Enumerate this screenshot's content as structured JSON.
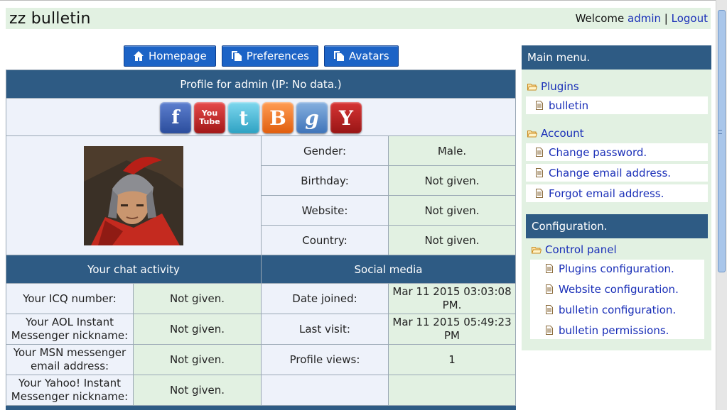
{
  "header": {
    "title": "zz bulletin",
    "welcome_text": "Welcome",
    "user_link": "admin",
    "separator": "|",
    "logout_link": "Logout"
  },
  "nav_buttons": {
    "homepage": "Homepage",
    "preferences": "Preferences",
    "avatars": "Avatars"
  },
  "profile": {
    "heading": "Profile for admin (IP: No data.)",
    "social_icons": [
      "facebook-icon",
      "youtube-icon",
      "twitter-icon",
      "blogger-icon",
      "google-icon",
      "yahoo-icon"
    ],
    "youtube_top": "You",
    "youtube_bottom": "Tube",
    "fields": [
      {
        "label": "Gender:",
        "value": "Male."
      },
      {
        "label": "Birthday:",
        "value": "Not given."
      },
      {
        "label": "Website:",
        "value": "Not given."
      },
      {
        "label": "Country:",
        "value": "Not given."
      }
    ]
  },
  "chat_activity": {
    "heading": "Your chat activity",
    "rows": [
      {
        "label": "Your ICQ number:",
        "value": "Not given."
      },
      {
        "label": "Your AOL Instant Messenger nickname:",
        "value": "Not given."
      },
      {
        "label": "Your MSN messenger email address:",
        "value": "Not given."
      },
      {
        "label": "Your Yahoo! Instant Messenger nickname:",
        "value": "Not given."
      }
    ]
  },
  "social_media": {
    "heading": "Social media",
    "rows": [
      {
        "label": "Date joined:",
        "value": "Mar 11 2015 03:03:08 PM."
      },
      {
        "label": "Last visit:",
        "value": "Mar 11 2015 05:49:23 PM"
      },
      {
        "label": "Profile views:",
        "value": "1"
      },
      {
        "label": "",
        "value": ""
      }
    ]
  },
  "sidebar": {
    "main_menu_title": "Main menu.",
    "plugins_folder": "Plugins",
    "plugins_items": [
      "bulletin"
    ],
    "account_folder": "Account",
    "account_items": [
      "Change password.",
      "Change email address.",
      "Forgot email address."
    ],
    "config_title": "Configuration.",
    "control_panel_folder": "Control panel",
    "config_items": [
      "Plugins configuration.",
      "Website configuration.",
      "bulletin configuration.",
      "bulletin permissions."
    ]
  },
  "colors": {
    "header_bg": "#e2f1e2",
    "table_head": "#2e5b84",
    "button_blue": "#1c63c6",
    "link_blue": "#1a2fb8"
  }
}
